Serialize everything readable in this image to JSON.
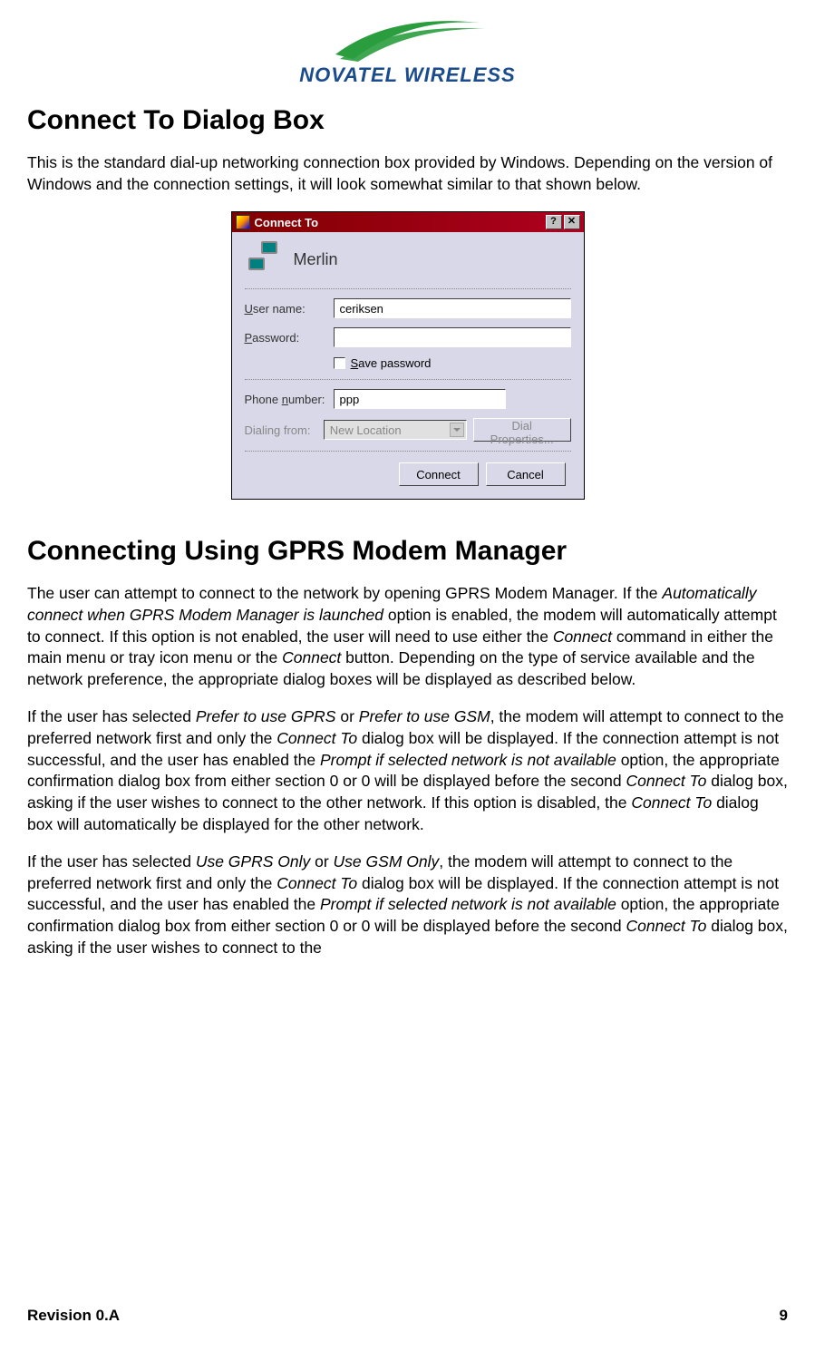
{
  "logo": {
    "brand": "NOVATEL WIRELESS"
  },
  "section1": {
    "heading": "Connect To Dialog Box",
    "paragraph": "This is the standard dial-up networking connection box provided by Windows.  Depending on the version of Windows and the connection settings, it will look somewhat similar to that shown below."
  },
  "dialog": {
    "title": "Connect To",
    "help_btn": "?",
    "close_btn": "✕",
    "connection_name": "Merlin",
    "username_label": "User name:",
    "username_value": "ceriksen",
    "password_label": "Password:",
    "password_value": "",
    "save_password_label": "Save password",
    "phone_label": "Phone number:",
    "phone_value": "ppp",
    "dialing_label": "Dialing from:",
    "dialing_value": "New Location",
    "dial_properties_btn": "Dial Properties...",
    "connect_btn": "Connect",
    "cancel_btn": "Cancel"
  },
  "section2": {
    "heading": "Connecting Using GPRS Modem Manager",
    "p1_a": "The user can attempt to connect to the network by opening GPRS Modem Manager.  If the ",
    "p1_i1": "Automatically connect when GPRS Modem Manager is launched",
    "p1_b": " option is enabled, the modem will automatically attempt to connect.  If this option is not enabled, the user will need to use either the ",
    "p1_i2": "Connect",
    "p1_c": " command in either the main menu or tray icon menu or the ",
    "p1_i3": "Connect",
    "p1_d": " button.  Depending on the type of service available and the network preference, the appropriate dialog boxes will be displayed as described below.",
    "p2_a": "If the user has selected ",
    "p2_i1": "Prefer to use GPRS",
    "p2_b": " or ",
    "p2_i2": "Prefer to use GSM",
    "p2_c": ", the modem will attempt to connect to the preferred network first and only the ",
    "p2_i3": "Connect To",
    "p2_d": " dialog box will be displayed.  If the connection attempt is not successful, and the user has enabled the ",
    "p2_i4": "Prompt if selected network is not available",
    "p2_e": " option, the appropriate confirmation dialog box from either section 0 or 0 will be displayed before the second ",
    "p2_i5": "Connect To",
    "p2_f": " dialog box, asking if the user wishes to connect to the other network.  If this option is disabled, the ",
    "p2_i6": "Connect To",
    "p2_g": " dialog box will automatically be displayed for the other network.",
    "p3_a": "If the user has selected ",
    "p3_i1": "Use GPRS Only",
    "p3_b": " or ",
    "p3_i2": "Use GSM Only",
    "p3_c": ", the modem will attempt to connect to the preferred network first and only the ",
    "p3_i3": "Connect To",
    "p3_d": " dialog box will be displayed.  If the connection attempt is not successful, and the user has enabled the ",
    "p3_i4": "Prompt if selected network is not available",
    "p3_e": " option, the appropriate confirmation dialog box from either section 0 or 0 will be displayed before the second ",
    "p3_i5": "Connect To",
    "p3_f": " dialog box, asking if the user wishes to connect to the"
  },
  "footer": {
    "revision": "Revision 0.A",
    "page": "9"
  }
}
